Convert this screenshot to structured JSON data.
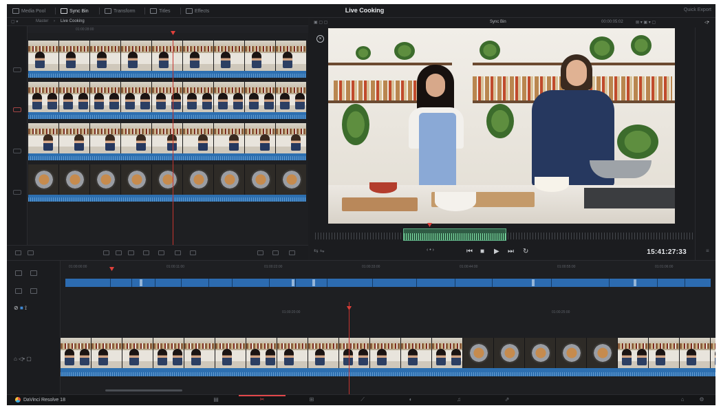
{
  "app": {
    "project_title": "Live Cooking",
    "quick_export": "Quick Export",
    "brand": "DaVinci Resolve 18"
  },
  "toolbar": {
    "items": [
      {
        "label": "Media Pool",
        "icon": "media-pool-icon"
      },
      {
        "label": "Sync Bin",
        "icon": "sync-bin-icon",
        "active": true
      },
      {
        "label": "Transform",
        "icon": "transform-icon"
      },
      {
        "label": "Titles",
        "icon": "titles-icon"
      },
      {
        "label": "Effects",
        "icon": "effects-icon"
      }
    ]
  },
  "left_panel": {
    "breadcrumb": [
      "Master",
      "Live Cooking"
    ],
    "ruler_time": "01:00:28:00"
  },
  "viewer": {
    "title": "Sync Bin",
    "timecode_small": "00:00:05:02",
    "timecode": "15:41:27:33",
    "transport": [
      "prev-icon",
      "stop-icon",
      "play-icon",
      "next-icon",
      "loop-icon"
    ]
  },
  "timeline": {
    "upper_ruler": [
      "01:00:00:00",
      "01:00:11:00",
      "01:00:22:00",
      "01:00:33:00",
      "01:00:44:00",
      "01:00:55:00",
      "01:01:06:00"
    ],
    "lower_ruler": [
      "01:00:20:00",
      "01:00:25:00"
    ]
  },
  "pages": [
    {
      "name": "media-page",
      "icon": "media-icon"
    },
    {
      "name": "cut-page",
      "icon": "cut-icon",
      "active": true
    },
    {
      "name": "edit-page",
      "icon": "edit-icon"
    },
    {
      "name": "fusion-page",
      "icon": "fusion-icon"
    },
    {
      "name": "color-page",
      "icon": "color-icon"
    },
    {
      "name": "fairlight-page",
      "icon": "fairlight-icon"
    },
    {
      "name": "deliver-page",
      "icon": "deliver-icon"
    }
  ],
  "colors": {
    "accent": "#e2474a",
    "clip_blue": "#2d6fb0",
    "panel": "#1c1d20"
  }
}
